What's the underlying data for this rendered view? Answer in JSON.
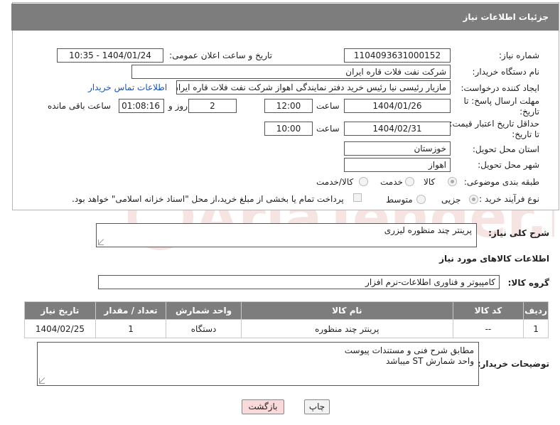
{
  "header": {
    "title": "جزئیات اطلاعات نیاز"
  },
  "fields": {
    "need_number_label": "شماره نیاز:",
    "need_number": "1104093631000152",
    "announce_label": "تاریخ و ساعت اعلان عمومی:",
    "announce_value": "1404/01/24 - 10:35",
    "buyer_label": "نام دستگاه خریدار:",
    "buyer_value": "شرکت نفت فلات قاره ایران",
    "creator_label": "ایجاد کننده درخواست:",
    "creator_value": "مازیار رئیسی نیا رئیس خرید دفتر نمایندگی اهواز شرکت نفت فلات قاره ایران",
    "contact_link": "اطلاعات تماس خریدار",
    "deadline_label": "مهلت ارسال پاسخ: تا تاریخ:",
    "deadline_date": "1404/01/26",
    "time_label": "ساعت",
    "deadline_time": "12:00",
    "days_value": "2",
    "days_label": "روز و",
    "remaining_value": "01:08:16",
    "remaining_label": "ساعت باقی مانده",
    "price_label": "حداقل تاریخ اعتبار قیمت: تا تاریخ:",
    "price_date": "1404/02/31",
    "price_time": "10:00",
    "province_label": "استان محل تحویل:",
    "province_value": "خوزستان",
    "city_label": "شهر محل تحویل:",
    "city_value": "اهواز",
    "category_label": "طبقه بندی موضوعی:",
    "category_options": [
      "کالا",
      "خدمت",
      "کالا/خدمت"
    ],
    "process_label": "نوع فرآیند خرید :",
    "process_options": [
      "جزیی",
      "متوسط"
    ],
    "payment_note": "پرداخت تمام یا بخشی از مبلغ خرید،از محل \"اسناد خزانه اسلامی\" خواهد بود."
  },
  "summary": {
    "label": "شرح کلی نیاز:",
    "value": "پرینتر چند منظوره لیزری"
  },
  "goods": {
    "section_title": "اطلاعات کالاهای مورد نیاز",
    "group_label": "گروه کالا:",
    "group_value": "کامپیوتر و فناوری اطلاعات-نرم افزار"
  },
  "table": {
    "headers": [
      "ردیف",
      "کد کالا",
      "نام کالا",
      "واحد شمارش",
      "تعداد / مقدار",
      "تاریخ نیاز"
    ],
    "rows": [
      [
        "1",
        "--",
        "پرینتر چند منظوره",
        "دستگاه",
        "1",
        "1404/02/25"
      ]
    ]
  },
  "buyer_notes": {
    "label": "توضیحات خریدار:",
    "line1": "مطابق شرح فنی و مستندات پیوست",
    "line2": "واحد شمارش  ST  میباشد"
  },
  "buttons": {
    "print": "چاپ",
    "back": "بازگشت"
  },
  "watermark": {
    "text": "AriaTender.neT"
  }
}
